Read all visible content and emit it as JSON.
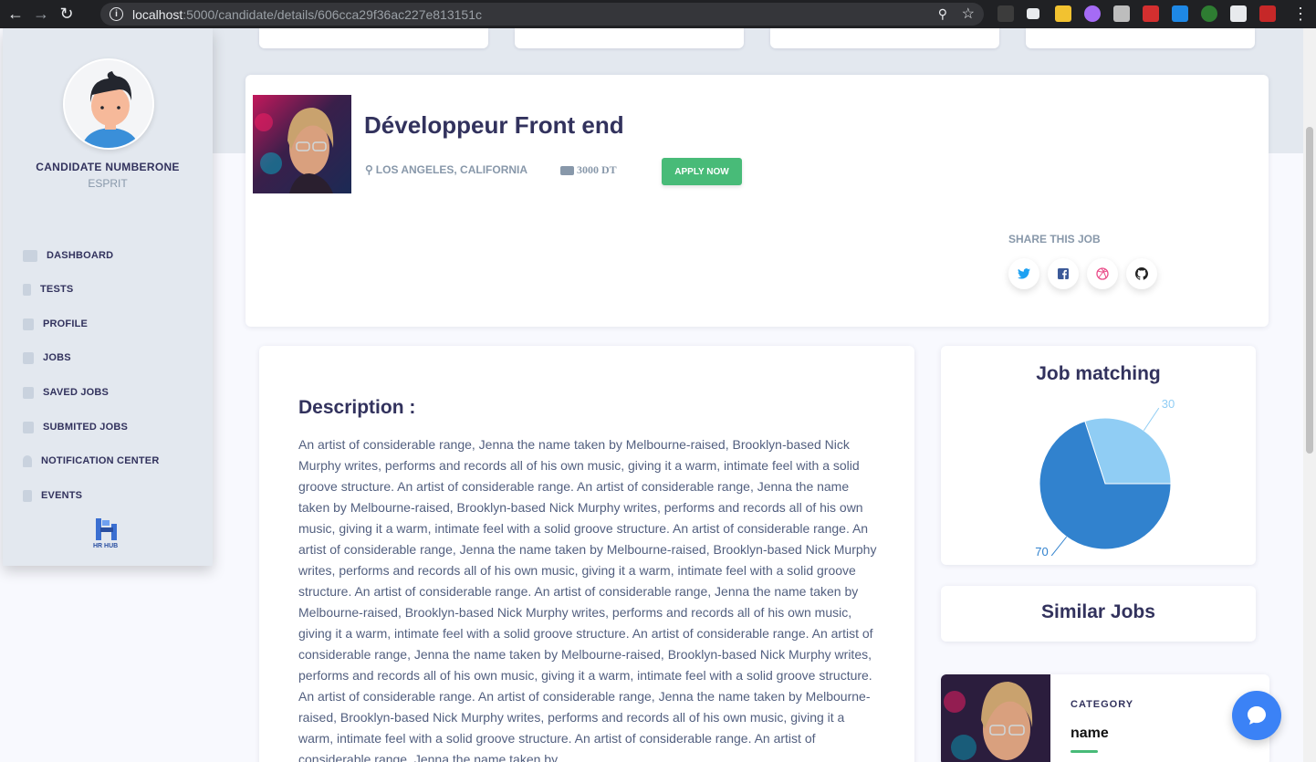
{
  "browser": {
    "url_host": "localhost",
    "url_path": ":5000/candidate/details/606cca29f36ac227e813151c"
  },
  "sidebar": {
    "candidate_name": "CANDIDATE NUMBERONE",
    "candidate_org": "ESPRIT",
    "items": [
      {
        "label": "DASHBOARD",
        "icon": "monitor-icon"
      },
      {
        "label": "TESTS",
        "icon": "file-icon"
      },
      {
        "label": "PROFILE",
        "icon": "briefcase-icon"
      },
      {
        "label": "JOBS",
        "icon": "briefcase-icon"
      },
      {
        "label": "SAVED JOBS",
        "icon": "briefcase-icon"
      },
      {
        "label": "SUBMITED JOBS",
        "icon": "briefcase-icon"
      },
      {
        "label": "NOTIFICATION CENTER",
        "icon": "bell-icon"
      },
      {
        "label": "EVENTS",
        "icon": "calendar-icon"
      }
    ],
    "logo_text": "HR HUB"
  },
  "job": {
    "title": "Développeur Front end",
    "location": "LOS ANGELES, CALIFORNIA",
    "salary": "3000 DT",
    "apply_label": "APPLY NOW",
    "share_title": "SHARE THIS JOB",
    "social": [
      {
        "name": "twitter-icon",
        "glyph": "🐦",
        "color": "#1da1f2"
      },
      {
        "name": "facebook-icon",
        "glyph": "f",
        "color": "#3b5998"
      },
      {
        "name": "dribbble-icon",
        "glyph": "◎",
        "color": "#ea4c89"
      },
      {
        "name": "github-icon",
        "glyph": "●",
        "color": "#222"
      }
    ]
  },
  "description": {
    "title": "Description :",
    "text": "An artist of considerable range, Jenna the name taken by Melbourne-raised, Brooklyn-based Nick Murphy writes, performs and records all of his own music, giving it a warm, intimate feel with a solid groove structure. An artist of considerable range. An artist of considerable range, Jenna the name taken by Melbourne-raised, Brooklyn-based Nick Murphy writes, performs and records all of his own music, giving it a warm, intimate feel with a solid groove structure. An artist of considerable range. An artist of considerable range, Jenna the name taken by Melbourne-raised, Brooklyn-based Nick Murphy writes, performs and records all of his own music, giving it a warm, intimate feel with a solid groove structure. An artist of considerable range. An artist of considerable range, Jenna the name taken by Melbourne-raised, Brooklyn-based Nick Murphy writes, performs and records all of his own music, giving it a warm, intimate feel with a solid groove structure. An artist of considerable range. An artist of considerable range, Jenna the name taken by Melbourne-raised, Brooklyn-based Nick Murphy writes, performs and records all of his own music, giving it a warm, intimate feel with a solid groove structure. An artist of considerable range. An artist of considerable range, Jenna the name taken by Melbourne-raised, Brooklyn-based Nick Murphy writes, performs and records all of his own music, giving it a warm, intimate feel with a solid groove structure. An artist of considerable range. An artist of considerable range, Jenna the name taken by"
  },
  "matching": {
    "title": "Job matching"
  },
  "chart_data": {
    "type": "pie",
    "categories": [
      "30",
      "70"
    ],
    "values": [
      30,
      70
    ],
    "colors": [
      "#90cdf4",
      "#3182ce"
    ]
  },
  "similar": {
    "title": "Similar Jobs",
    "category_label": "CATEGORY",
    "job_name": "name"
  },
  "colors": {
    "accent_green": "#48bb78",
    "chat_blue": "#3b82f6"
  }
}
